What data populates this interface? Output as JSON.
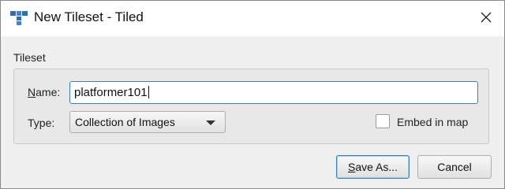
{
  "window": {
    "title": "New Tileset - Tiled",
    "app_icon": "tiled-t-icon",
    "close_icon": "close-icon"
  },
  "tileset_group": {
    "label": "Tileset",
    "name": {
      "label_mnemonic": "N",
      "label_rest": "ame:",
      "value": "platformer101"
    },
    "type": {
      "label": "Type:",
      "selected": "Collection of Images",
      "arrow_icon": "chevron-down-icon"
    },
    "embed": {
      "label": "Embed in map",
      "checked": false
    }
  },
  "buttons": {
    "save_mnemonic": "S",
    "save_rest": "ave As...",
    "cancel": "Cancel"
  }
}
